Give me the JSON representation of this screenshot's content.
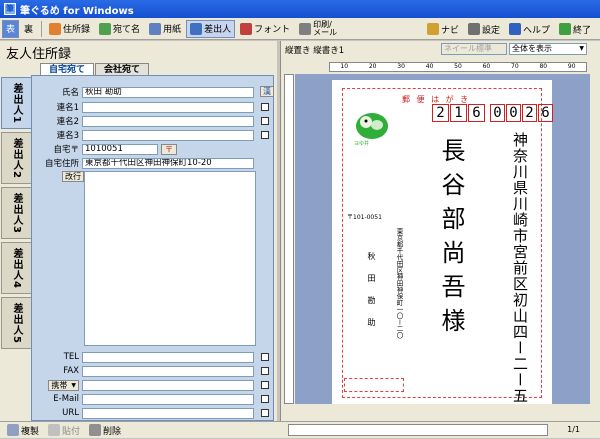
{
  "window": {
    "title": "筆ぐるめ for Windows"
  },
  "toolbar": {
    "omote": "表",
    "ura": "裏",
    "jushoroku": "住所録",
    "atena": "宛て名",
    "yoshi": "用紙",
    "sashidashinin": "差出人",
    "font": "フォント",
    "print_mail_line1": "印刷/",
    "print_mail_line2": "メール",
    "navi": "ナビ",
    "settei": "設定",
    "help": "ヘルプ",
    "exit": "終了"
  },
  "left": {
    "title": "友人住所録",
    "vtabs": [
      "差出人1",
      "差出人2",
      "差出人3",
      "差出人4",
      "差出人5"
    ],
    "htabs": [
      "自宅宛て",
      "会社宛て"
    ],
    "fields": {
      "name_label": "氏名",
      "name_value": "秋田 勘助",
      "name_badge": "漢",
      "renmei1_label": "連名1",
      "renmei2_label": "連名2",
      "renmei3_label": "連名3",
      "zip_label": "自宅〒",
      "zip_value": "1010051",
      "zip_btn": "〒",
      "addr_label": "自宅住所",
      "addr_value": "東京都千代田区神田神保町10-20",
      "kaigyo": "改行",
      "tel_label": "TEL",
      "fax_label": "FAX",
      "mobile_label": "携帯",
      "email_label": "E-Mail",
      "url_label": "URL"
    }
  },
  "bottom": {
    "fukusei": "複製",
    "haritsuke": "貼付",
    "sakujo": "削除"
  },
  "right": {
    "mode": "縦置き 縦書き1",
    "zoom_select": "全体を表示",
    "disabled_select": "ネイール標準",
    "ruler_ticks": [
      "10",
      "20",
      "30",
      "40",
      "50",
      "60",
      "70",
      "80",
      "90"
    ],
    "page_count": "1/1"
  },
  "card": {
    "header": "郵 便 は が き",
    "zip_digits": [
      "2",
      "1",
      "6",
      "0",
      "0",
      "2",
      "6"
    ],
    "recipient_address": "神奈川県川崎市宮前区初山四ー二ー五",
    "recipient_name": "長谷部尚吾様",
    "sender_zip": "〒101-0051",
    "sender_address": "東京都千代田区神田神保町一〇ー二〇",
    "sender_name": "秋田勘助",
    "stamp_text": "ヨゆ井"
  },
  "colors": {
    "accent": "#1550d0",
    "postal_red": "#d02020",
    "panel_blue": "#c5d6ea"
  }
}
